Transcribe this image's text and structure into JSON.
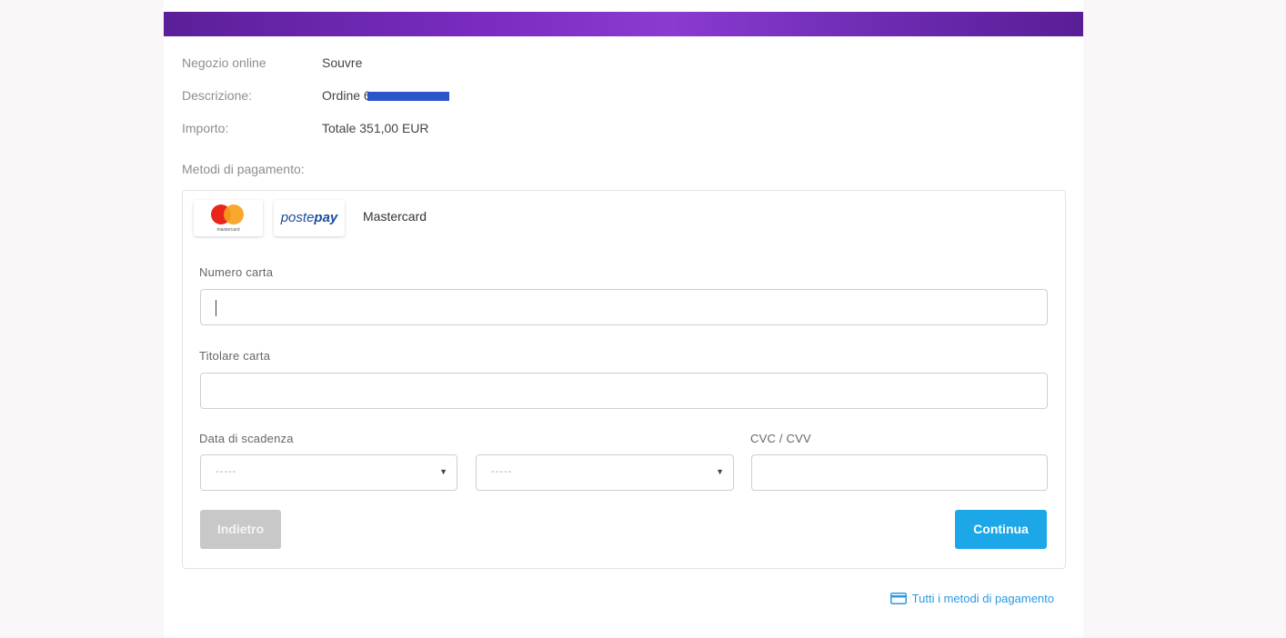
{
  "summary": {
    "shop_label": "Negozio online",
    "shop_value": "Souvre",
    "description_label": "Descrizione:",
    "description_value": "Ordine 6",
    "amount_label": "Importo:",
    "amount_value": "Totale 351,00 EUR"
  },
  "payment_methods": {
    "title": "Metodi di pagamento:",
    "mastercard_logo_icon": "mastercard-logo-icon",
    "mastercard_logo_caption": "mastercard",
    "postepay_logo_text_light": "poste",
    "postepay_logo_text_bold": "pay",
    "selected_brand": "Mastercard"
  },
  "form": {
    "card_number_label": "Numero carta",
    "card_number_value": "",
    "cardholder_label": "Titolare carta",
    "cardholder_value": "",
    "expiry_label": "Data di scadenza",
    "expiry_month_value": "-----",
    "expiry_year_value": "-----",
    "cvc_label": "CVC / CVV",
    "cvc_value": ""
  },
  "buttons": {
    "back_label": "Indietro",
    "continue_label": "Continua"
  },
  "footer": {
    "all_methods_label": "Tutti i metodi di pagamento",
    "all_methods_icon": "credit-card-icon"
  },
  "colors": {
    "banner": "#7a2cc0",
    "primary_button": "#1ba7e8",
    "disabled_button": "#c8c8c8",
    "link": "#2d9ae0",
    "mastercard_red": "#e9241c",
    "mastercard_orange": "#f6a11b",
    "postepay_blue": "#1a4ea1"
  }
}
